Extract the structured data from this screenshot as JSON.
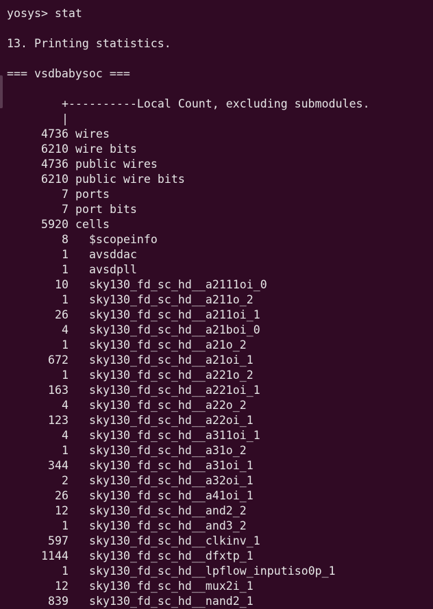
{
  "terminal": {
    "prompt": "yosys> stat",
    "step": "13. Printing statistics.",
    "module_header": "=== vsdbabysoc ===",
    "tree_header": "+----------Local Count, excluding submodules.",
    "tree_pipe": "|"
  },
  "stats": [
    {
      "count": "4736",
      "label": "wires"
    },
    {
      "count": "6210",
      "label": "wire bits"
    },
    {
      "count": "4736",
      "label": "public wires"
    },
    {
      "count": "6210",
      "label": "public wire bits"
    },
    {
      "count": "7",
      "label": "ports"
    },
    {
      "count": "7",
      "label": "port bits"
    },
    {
      "count": "5920",
      "label": "cells"
    }
  ],
  "cells": [
    {
      "count": "8",
      "name": "$scopeinfo"
    },
    {
      "count": "1",
      "name": "avsddac"
    },
    {
      "count": "1",
      "name": "avsdpll"
    },
    {
      "count": "10",
      "name": "sky130_fd_sc_hd__a2111oi_0"
    },
    {
      "count": "1",
      "name": "sky130_fd_sc_hd__a211o_2"
    },
    {
      "count": "26",
      "name": "sky130_fd_sc_hd__a211oi_1"
    },
    {
      "count": "4",
      "name": "sky130_fd_sc_hd__a21boi_0"
    },
    {
      "count": "1",
      "name": "sky130_fd_sc_hd__a21o_2"
    },
    {
      "count": "672",
      "name": "sky130_fd_sc_hd__a21oi_1"
    },
    {
      "count": "1",
      "name": "sky130_fd_sc_hd__a221o_2"
    },
    {
      "count": "163",
      "name": "sky130_fd_sc_hd__a221oi_1"
    },
    {
      "count": "4",
      "name": "sky130_fd_sc_hd__a22o_2"
    },
    {
      "count": "123",
      "name": "sky130_fd_sc_hd__a22oi_1"
    },
    {
      "count": "4",
      "name": "sky130_fd_sc_hd__a311oi_1"
    },
    {
      "count": "1",
      "name": "sky130_fd_sc_hd__a31o_2"
    },
    {
      "count": "344",
      "name": "sky130_fd_sc_hd__a31oi_1"
    },
    {
      "count": "2",
      "name": "sky130_fd_sc_hd__a32oi_1"
    },
    {
      "count": "26",
      "name": "sky130_fd_sc_hd__a41oi_1"
    },
    {
      "count": "12",
      "name": "sky130_fd_sc_hd__and2_2"
    },
    {
      "count": "1",
      "name": "sky130_fd_sc_hd__and3_2"
    },
    {
      "count": "597",
      "name": "sky130_fd_sc_hd__clkinv_1"
    },
    {
      "count": "1144",
      "name": "sky130_fd_sc_hd__dfxtp_1"
    },
    {
      "count": "1",
      "name": "sky130_fd_sc_hd__lpflow_inputiso0p_1"
    },
    {
      "count": "12",
      "name": "sky130_fd_sc_hd__mux2i_1"
    },
    {
      "count": "839",
      "name": "sky130_fd_sc_hd__nand2_1"
    }
  ],
  "colors": {
    "background": "#300a24",
    "text": "#e6e6e6"
  }
}
